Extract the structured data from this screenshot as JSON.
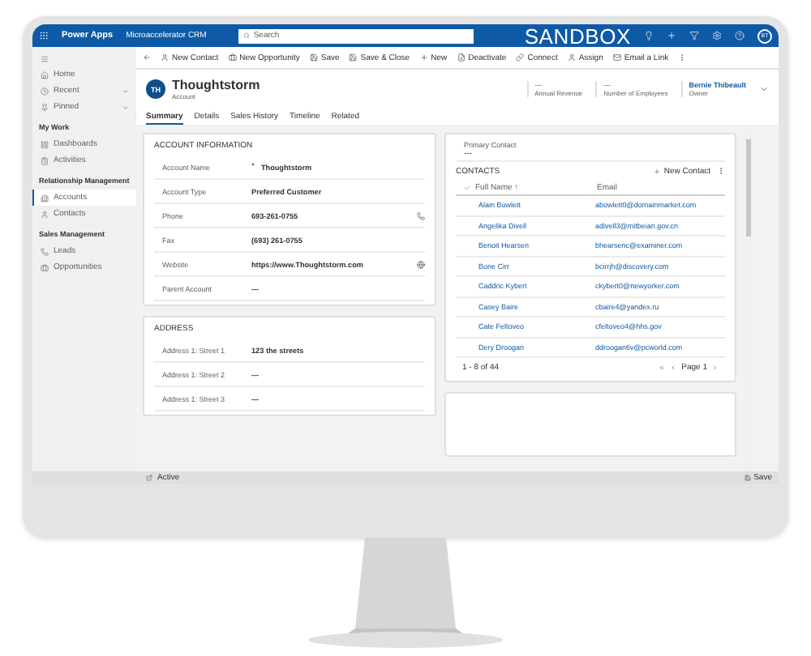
{
  "top_bar": {
    "app": "Power Apps",
    "environment": "Microaccelerator CRM",
    "search": {
      "placeholder": "Search"
    },
    "banner": "SANDBOX",
    "avatar": "BT"
  },
  "sidebar": {
    "items": [
      {
        "kind": "item",
        "label": "Home",
        "selected": false
      },
      {
        "kind": "expander",
        "label": "Recent",
        "selected": false
      },
      {
        "kind": "expander",
        "label": "Pinned",
        "selected": false
      },
      {
        "kind": "heading",
        "label": "My Work"
      },
      {
        "kind": "item",
        "label": "Dashboards",
        "selected": false
      },
      {
        "kind": "item",
        "label": "Activities",
        "selected": false
      },
      {
        "kind": "heading",
        "label": "Relationship Management"
      },
      {
        "kind": "item",
        "label": "Accounts",
        "selected": true
      },
      {
        "kind": "item",
        "label": "Contacts",
        "selected": false
      },
      {
        "kind": "heading",
        "label": "Sales Management"
      },
      {
        "kind": "item",
        "label": "Leads",
        "selected": false
      },
      {
        "kind": "item",
        "label": "Opportunities",
        "selected": false
      }
    ]
  },
  "command_bar": [
    "New Contact",
    "New Opportunity",
    "Save",
    "Save & Close",
    "New",
    "Deactivate",
    "Connect",
    "Assign",
    "Email a Link"
  ],
  "record": {
    "initials": "TH",
    "name": "Thoughtstorm",
    "type": "Account",
    "header_fields": [
      {
        "value": "---",
        "label": "Annual Revenue"
      },
      {
        "value": "---",
        "label": "Number of Employees"
      },
      {
        "value": "Bernie Thibeault",
        "label": "Owner",
        "kind": "link"
      }
    ]
  },
  "tabs": [
    {
      "label": "Summary",
      "selected": true
    },
    {
      "label": "Details",
      "selected": false
    },
    {
      "label": "Sales History",
      "selected": false
    },
    {
      "label": "Timeline",
      "selected": false
    },
    {
      "label": "Related",
      "selected": false
    }
  ],
  "sections": [
    {
      "title": "ACCOUNT INFORMATION",
      "fields": [
        {
          "label": "Account Name",
          "required_mark": "*",
          "value": "Thoughtstorm"
        },
        {
          "label": "Account Type",
          "value": "Preferred Customer"
        },
        {
          "label": "Phone",
          "value": "693-261-0755"
        },
        {
          "label": "Fax",
          "value": "(693) 261-0755"
        },
        {
          "label": "Website",
          "value": "https://www.Thoughtstorm.com"
        },
        {
          "label": "Parent Account",
          "value": "---"
        }
      ]
    },
    {
      "title": "ADDRESS",
      "fields": [
        {
          "label": "Address 1: Street 1",
          "value": "123 the streets"
        },
        {
          "label": "Address 1: Street 2",
          "value": "---"
        },
        {
          "label": "Address 1: Street 3",
          "value": "---"
        }
      ]
    }
  ],
  "primary_contact": {
    "label": "Primary Contact",
    "value": "---"
  },
  "contacts": {
    "title": "CONTACTS",
    "new_button": "New Contact",
    "columns": [
      "Full Name ↑",
      "Email"
    ],
    "rows": [
      [
        "Alain Bowlett",
        "abowlett0@domainmarket.com"
      ],
      [
        "Angelika Divell",
        "adivell3@mitbeian.gov.cn"
      ],
      [
        "Benoit Hearsen",
        "bhearsenc@examiner.com"
      ],
      [
        "Bone Cirr",
        "bcirrjh@discovery.com"
      ],
      [
        "Caddric Kybert",
        "ckybert0@newyorker.com"
      ],
      [
        "Casey Baire",
        "cbaire4@yandex.ru"
      ],
      [
        "Cate Feltoveo",
        "cfeltoveo4@hhs.gov"
      ],
      [
        "Dery Droogan",
        "ddroogan6v@pcworld.com"
      ]
    ],
    "count": "1 - 8 of 44",
    "page": "Page 1"
  },
  "status_bar": {
    "status": "Active",
    "save": "Save"
  }
}
